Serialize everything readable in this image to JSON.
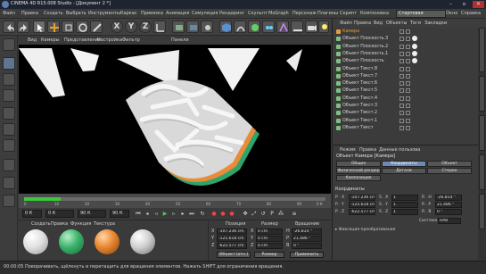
{
  "window": {
    "title": "CINEMA 4D R15.008 Studio - [Документ 2 *]"
  },
  "menu": [
    "Файл",
    "Правка",
    "Создать",
    "Выбрать",
    "Инструменты",
    "Каркас",
    "Привязка",
    "Анимация",
    "Симуляция",
    "Рендеринг",
    "Скульпт",
    "MoGraph",
    "Персонаж",
    "Плагины",
    "Скрипт",
    "Окно",
    "Справка"
  ],
  "layout": {
    "label": "Компоновка",
    "value": "Стартовая"
  },
  "viewport_menu": [
    "Вид",
    "Камеры",
    "Представление",
    "Настройка",
    "Фильтр",
    "Панели"
  ],
  "timeline": {
    "ticks": [
      "0",
      "10",
      "20",
      "30",
      "40",
      "50",
      "60",
      "70",
      "80",
      "90"
    ],
    "end_label": "0 К",
    "progress": 0.12
  },
  "playback": {
    "start": "0 К",
    "current": "0 К",
    "end": "90 К",
    "end2": "90 К"
  },
  "material_manager": {
    "menu": [
      "Создать",
      "Правка",
      "Функция",
      "Текстура"
    ]
  },
  "coordinates": {
    "headers": [
      "Позиция",
      "Размер",
      "Вращение"
    ],
    "axes": [
      "X",
      "Y",
      "Z"
    ],
    "position": [
      "-107.236 cm",
      "-125.618 cm",
      "-622.577 cm"
    ],
    "size": [
      "0 cm",
      "0 cm",
      "0 cm"
    ],
    "rotation_labels": [
      "H",
      "P",
      "B"
    ],
    "rotation": [
      "-26.814 °",
      "21.486 °",
      "0 °"
    ],
    "mode": "Объект (отн.)",
    "size_mode": "Размер",
    "apply": "Применить"
  },
  "status_text": "00:00:05   Поворачивать, щёлкнуть и перетащить для вращения элементов. Нажать SHIFT для ограничения вращения.",
  "object_manager": {
    "menu": [
      "Файл",
      "Правка",
      "Вид",
      "Объекты",
      "Теги",
      "Закладки"
    ],
    "objects": [
      "Камера",
      "Объект Плоскость.3",
      "Объект Плоскость.2",
      "Объект Плоскость.1",
      "Объект Плоскость",
      "Объект Текст.8",
      "Объект Текст.7",
      "Объект Текст.6",
      "Объект Текст.5",
      "Объект Текст.4",
      "Объект Текст.3",
      "Объект Текст.2",
      "Объект Текст.1",
      "Объект Текст"
    ],
    "camera_color": "#e89b3c",
    "object_color": "#7fbf7f"
  },
  "attribute_manager": {
    "menu": [
      "Режим",
      "Правка",
      "Данные пользова"
    ],
    "title": "Объект Камера [Камера]",
    "tabs_row1": [
      "Общие",
      "Координаты",
      "Объект"
    ],
    "tabs_row2": [
      "Физический рендер",
      "Детали",
      "Стерео"
    ],
    "tabs_row3": [
      "Композиция"
    ],
    "active_tab": "Координаты",
    "section": "Координаты",
    "rows": [
      {
        "p": "P . X",
        "pv": "-107.236 cm",
        "s": "S . X",
        "sv": "1",
        "r": "R . H",
        "rv": "-26.814 °"
      },
      {
        "p": "P . Y",
        "pv": "-125.618 cm",
        "s": "S . Y",
        "sv": "1",
        "r": "R . P",
        "rv": "21.486 °"
      },
      {
        "p": "P . Z",
        "pv": "-622.577 cm",
        "s": "S . Z",
        "sv": "1",
        "r": "R . B",
        "rv": "0 °"
      }
    ],
    "order_label": "Система",
    "order_value": "HPB",
    "freeze_label": "▸ Фиксация преобразования"
  }
}
